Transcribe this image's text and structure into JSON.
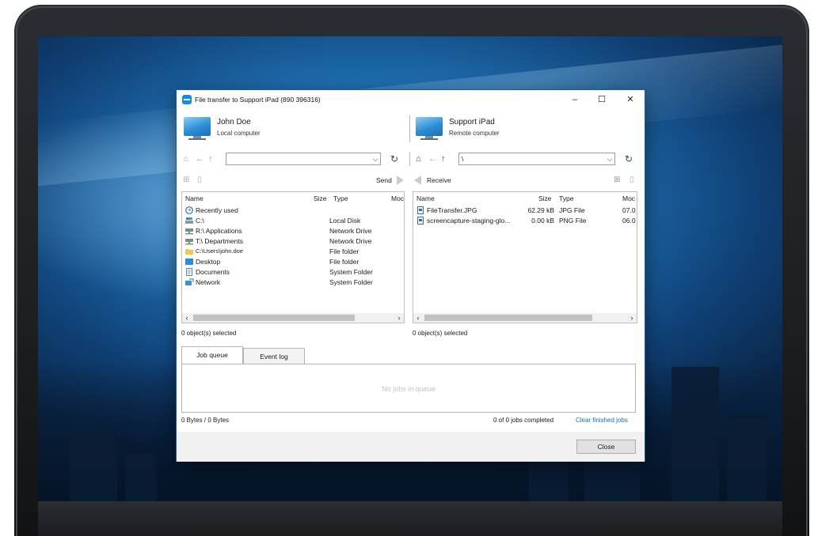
{
  "window": {
    "title": "File transfer to Support iPad (890 396316)",
    "minimize": "–",
    "maximize": "☐",
    "close": "✕"
  },
  "local": {
    "name": "John Doe",
    "subtitle": "Local computer",
    "path": "",
    "send_label": "Send",
    "columns": [
      "Name",
      "Size",
      "Type",
      "Moc"
    ],
    "items": [
      {
        "name": "Recently used",
        "size": "",
        "type": "",
        "icon": "clock-icon"
      },
      {
        "name": "C:\\",
        "size": "",
        "type": "Local Disk",
        "icon": "local-disk-icon"
      },
      {
        "name": "R:\\  Applications",
        "size": "",
        "type": "Network Drive",
        "icon": "network-drive-icon"
      },
      {
        "name": "T:\\  Departments",
        "size": "",
        "type": "Network Drive",
        "icon": "network-drive-icon"
      },
      {
        "name": "C:\\Users\\john.doe",
        "size": "",
        "type": "File folder",
        "icon": "folder-icon"
      },
      {
        "name": "Desktop",
        "size": "",
        "type": "File folder",
        "icon": "desktop-folder-icon"
      },
      {
        "name": "Documents",
        "size": "",
        "type": "System Folder",
        "icon": "documents-icon"
      },
      {
        "name": "Network",
        "size": "",
        "type": "System Folder",
        "icon": "network-icon"
      }
    ],
    "selection": "0 object(s) selected"
  },
  "remote": {
    "name": "Support iPad",
    "subtitle": "Remote computer",
    "path": "\\",
    "receive_label": "Receive",
    "columns": [
      "Name",
      "Size",
      "Type",
      "Moc"
    ],
    "items": [
      {
        "name": "FileTransfer.JPG",
        "size": "62.29 kB",
        "type": "JPG File",
        "modified": "07.0",
        "icon": "image-file-icon"
      },
      {
        "name": "screencapture-staging-glo...",
        "size": "0.00 kB",
        "type": "PNG File",
        "modified": "06.0",
        "icon": "image-file-icon"
      }
    ],
    "selection": "0 object(s) selected"
  },
  "tabs": [
    {
      "label": "Job queue",
      "active": true
    },
    {
      "label": "Event log",
      "active": false
    }
  ],
  "queue": {
    "empty_text": "No jobs in queue"
  },
  "status": {
    "bytes": "0 Bytes / 0 Bytes",
    "jobs": "0 of 0 jobs completed",
    "clear_link": "Clear finished jobs"
  },
  "footer": {
    "close_label": "Close"
  },
  "colors": {
    "accent": "#0e8ee9",
    "link": "#1b6ac6",
    "window_border": "#1e5c9a"
  }
}
